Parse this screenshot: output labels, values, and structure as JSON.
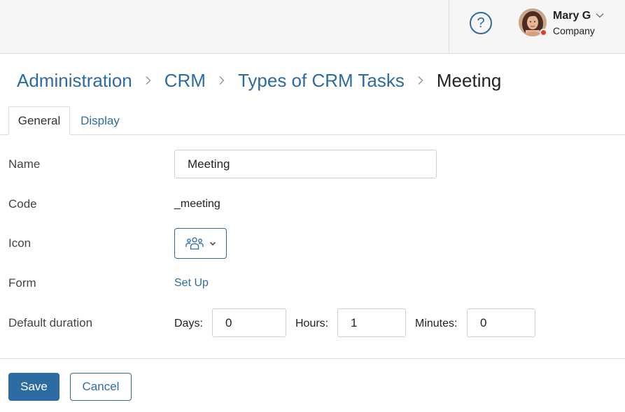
{
  "header": {
    "help_label": "?",
    "user": {
      "name": "Mary G",
      "company": "Company",
      "status_color": "#e33b2c"
    }
  },
  "breadcrumb": {
    "items": [
      "Administration",
      "CRM",
      "Types of CRM Tasks"
    ],
    "current": "Meeting"
  },
  "tabs": [
    {
      "label": "General",
      "active": true
    },
    {
      "label": "Display",
      "active": false
    }
  ],
  "form": {
    "name": {
      "label": "Name",
      "value": "Meeting"
    },
    "code": {
      "label": "Code",
      "value": "_meeting"
    },
    "icon": {
      "label": "Icon",
      "selected_icon": "people-group-icon"
    },
    "form": {
      "label": "Form",
      "link": "Set Up"
    },
    "duration": {
      "label": "Default duration",
      "days_label": "Days:",
      "days": "0",
      "hours_label": "Hours:",
      "hours": "1",
      "minutes_label": "Minutes:",
      "minutes": "0"
    }
  },
  "actions": {
    "save": "Save",
    "cancel": "Cancel"
  },
  "colors": {
    "accent": "#2d6ca2",
    "topbar_bg": "#f6f6f6",
    "border": "#dcdcdc"
  }
}
